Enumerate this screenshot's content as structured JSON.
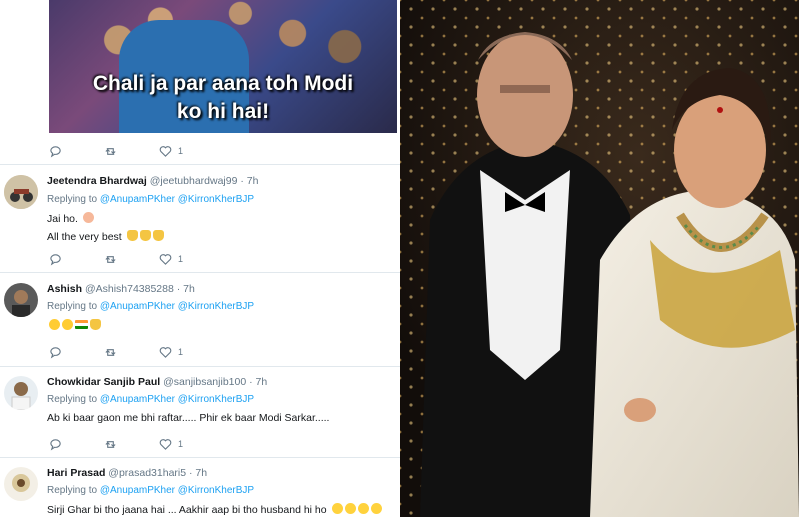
{
  "top_post": {
    "meme_caption": [
      "Chali ja par aana toh Modi",
      "ko hi hai!"
    ],
    "likes": "1"
  },
  "tweets": [
    {
      "name": "Jeetendra Bhardwaj",
      "handle": "@jeetubhardwaj99",
      "time": "· 7h",
      "replying_prefix": "Replying to ",
      "mentions": "@AnupamPKher @KirronKherBJP",
      "lines": [
        "Jai ho.",
        "All the very best"
      ],
      "likes": "1"
    },
    {
      "name": "Ashish",
      "handle": "@Ashish74385288",
      "time": "· 7h",
      "replying_prefix": "Replying to ",
      "mentions": "@AnupamPKher @KirronKherBJP",
      "lines": [
        ""
      ],
      "likes": "1"
    },
    {
      "name": "Chowkidar Sanjib Paul",
      "handle": "@sanjibsanjib100",
      "time": "· 7h",
      "replying_prefix": "Replying to ",
      "mentions": "@AnupamPKher @KirronKherBJP",
      "lines": [
        "Ab ki baar gaon me bhi raftar..... Phir ek baar Modi Sarkar....."
      ],
      "likes": "1"
    },
    {
      "name": "Hari Prasad",
      "handle": "@prasad31hari5",
      "time": "· 7h",
      "replying_prefix": "Replying to ",
      "mentions": "@AnupamPKher @KirronKherBJP",
      "lines": [
        "Sirji Ghar bi tho jaana hai ... Aakhir aap bi tho husband hi ho"
      ]
    }
  ],
  "icons": [
    "reply-icon",
    "retweet-icon",
    "like-icon"
  ],
  "colors": {
    "link": "#1da1f2",
    "muted": "#657786",
    "text": "#14171a",
    "divider": "#e1e8ed"
  }
}
